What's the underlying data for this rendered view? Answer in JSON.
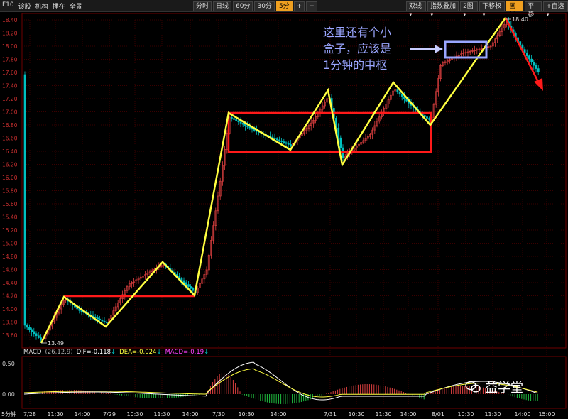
{
  "toolbar": {
    "left_items": [
      "F10",
      "诊股",
      "机构",
      "播在",
      "全景"
    ],
    "periods": [
      "分时",
      "日线",
      "60分",
      "30分",
      "5分"
    ],
    "active_period": "5分",
    "plus": "+",
    "minus": "−",
    "right_items": [
      "双线▾",
      "指数叠加▾",
      "2图▾",
      "下移权▾",
      "画线",
      "平移",
      "+自选▾"
    ],
    "active_right": "画线"
  },
  "price_axis": {
    "ticks": [
      "18.40",
      "18.20",
      "18.00",
      "17.80",
      "17.60",
      "17.40",
      "17.20",
      "17.00",
      "16.80",
      "16.60",
      "16.40",
      "16.20",
      "16.00",
      "15.80",
      "15.60",
      "15.40",
      "15.20",
      "15.00",
      "14.80",
      "14.60",
      "14.40",
      "14.20",
      "14.00",
      "13.80",
      "13.60"
    ],
    "high_label": "18.40",
    "low_label": "13.49"
  },
  "time_axis": {
    "period_label": "5分钟",
    "labels": [
      "7/28",
      "11:30",
      "14:00",
      "7/29",
      "10:30",
      "11:30",
      "14:00",
      "7/30",
      "10:30",
      "14:00",
      "7/31",
      "10:30",
      "11:30",
      "14:00",
      "8/01",
      "10:30",
      "11:30",
      "14:00",
      "15:00"
    ]
  },
  "annotation": {
    "text_lines": [
      "这里还有个小",
      "盒子，应该是",
      "1分钟的中枢"
    ]
  },
  "macd": {
    "name": "MACD",
    "params": "(26,12,9)",
    "dif_label": "DIF=",
    "dif_value": "-0.118",
    "dea_label": "DEA=",
    "dea_value": "-0.024",
    "macd_label": "MACD=",
    "macd_value": "-0.19",
    "axis_ticks": [
      "0.50",
      "0.00"
    ]
  },
  "colors": {
    "up": "#e04040",
    "down": "#00c0c0",
    "zhongshu": "#ff1a1a",
    "stroke_line": "#ffff40",
    "small_box": "#9aa6ff",
    "arrow": "#ff1a1a",
    "grid": "#3a0000"
  },
  "watermark": "益学堂"
}
